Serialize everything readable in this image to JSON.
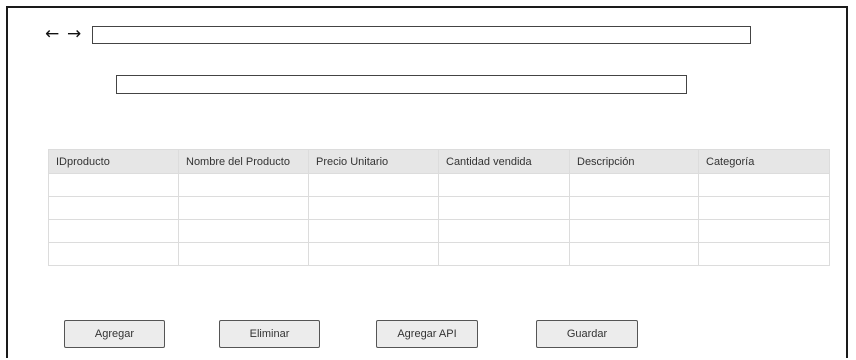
{
  "nav": {
    "back_glyph": "←",
    "forward_glyph": "→",
    "address_value": ""
  },
  "secondary_input": {
    "value": ""
  },
  "table": {
    "headers": [
      "IDproducto",
      "Nombre del Producto",
      "Precio Unitario",
      "Cantidad vendida",
      "Descripción",
      "Categoría"
    ],
    "rows": [
      [
        "",
        "",
        "",
        "",
        "",
        ""
      ],
      [
        "",
        "",
        "",
        "",
        "",
        ""
      ],
      [
        "",
        "",
        "",
        "",
        "",
        ""
      ],
      [
        "",
        "",
        "",
        "",
        "",
        ""
      ]
    ]
  },
  "actions": {
    "agregar_label": "Agregar",
    "eliminar_label": "Eliminar",
    "agregar_api_label": "Agregar API",
    "guardar_label": "Guardar"
  }
}
